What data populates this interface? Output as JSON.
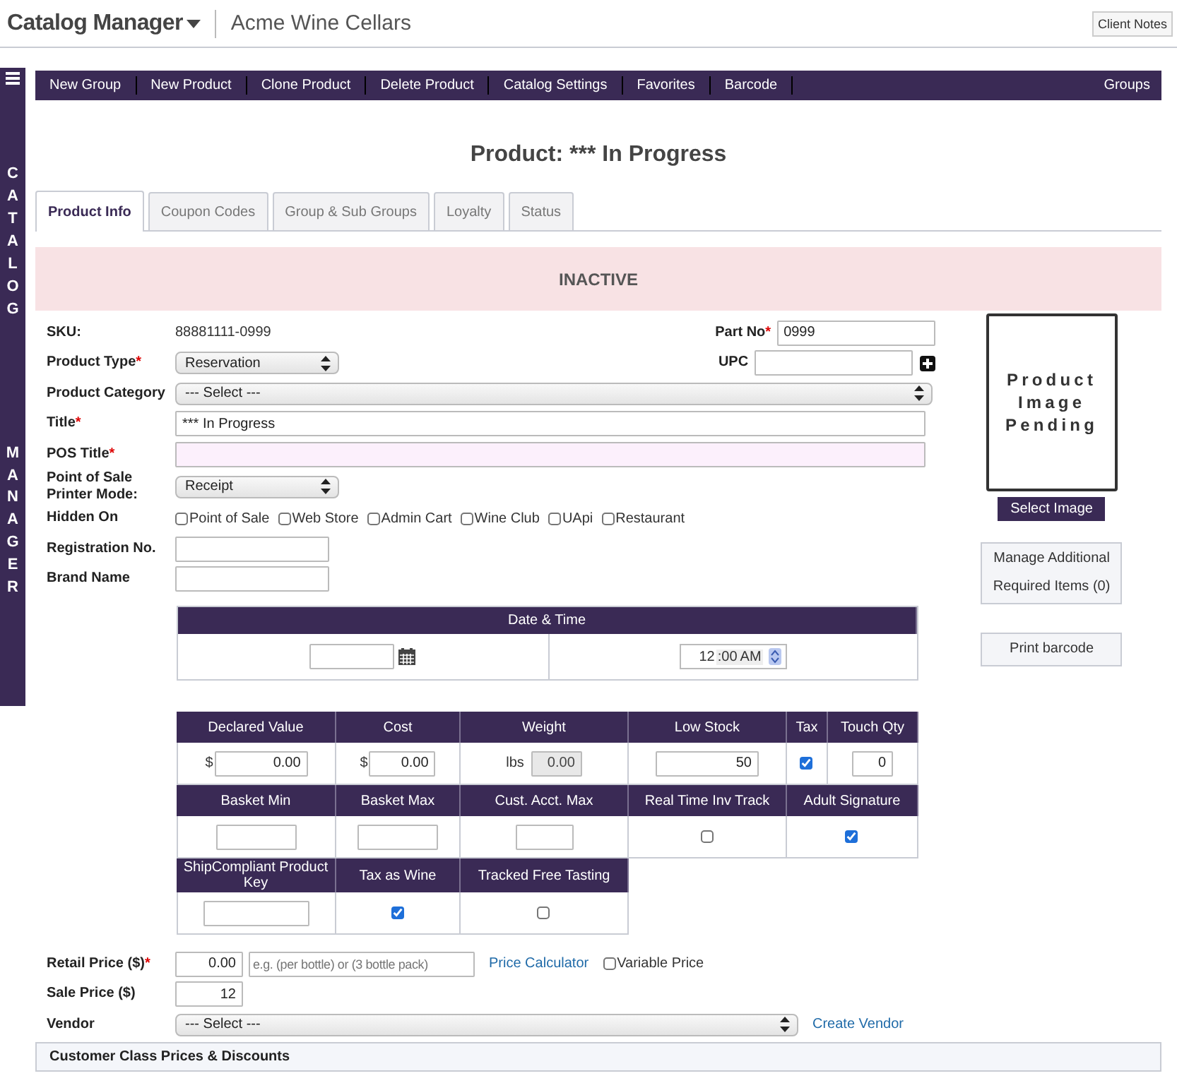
{
  "header": {
    "app_title": "Catalog Manager",
    "business": "Acme Wine Cellars",
    "client_notes": "Client Notes"
  },
  "sidebar": {
    "top_word": "CATALOG",
    "bottom_word": "MANAGER"
  },
  "toolbar": {
    "items": [
      "New Group",
      "New Product",
      "Clone Product",
      "Delete Product",
      "Catalog Settings",
      "Favorites",
      "Barcode"
    ],
    "right_item": "Groups"
  },
  "page_title": "Product: *** In Progress",
  "tabs": [
    {
      "label": "Product Info",
      "selected": true
    },
    {
      "label": "Coupon Codes",
      "selected": false
    },
    {
      "label": "Group & Sub Groups",
      "selected": false
    },
    {
      "label": "Loyalty",
      "selected": false
    },
    {
      "label": "Status",
      "selected": false
    }
  ],
  "status_banner": "INACTIVE",
  "form": {
    "rows": [
      {
        "label": "SKU:",
        "kind": "static",
        "value": "88881111-0999",
        "side": {
          "label": "Part No",
          "mark": "*",
          "value": "0999",
          "add_button": false
        }
      },
      {
        "label": "Product Type",
        "mark": "*",
        "kind": "select",
        "value": "Reservation",
        "side": {
          "label": "UPC",
          "add_button": true
        }
      },
      {
        "label": "Product Category",
        "kind": "wide-select",
        "value": "--- Select ---"
      },
      {
        "label": "Title",
        "mark": "*",
        "kind": "wide-input",
        "value": "*** In Progress",
        "highlighted": false
      },
      {
        "label": "POS Title",
        "mark": "*",
        "kind": "wide-input",
        "value": "",
        "highlighted": true
      },
      {
        "label": "Point of Sale Printer Mode:",
        "kind": "select",
        "value": "Receipt"
      },
      {
        "label": "Hidden On",
        "kind": "checkboxes",
        "options": [
          {
            "label": "Point of Sale",
            "checked": false
          },
          {
            "label": "Web Store",
            "checked": false
          },
          {
            "label": "Admin Cart",
            "checked": false
          },
          {
            "label": "Wine Club",
            "checked": false
          },
          {
            "label": "UApi",
            "checked": false
          },
          {
            "label": "Restaurant",
            "checked": false
          }
        ]
      },
      {
        "label": "Registration No.",
        "kind": "input",
        "value": ""
      },
      {
        "label": "Brand Name",
        "kind": "input",
        "value": ""
      }
    ]
  },
  "image_panel": {
    "placeholder": "Product Image Pending",
    "select_button": "Select Image",
    "manage_button": "Manage Additional Required Items (0)",
    "print_button": "Print barcode"
  },
  "date_time": {
    "title": "Date & Time",
    "hour": "12",
    "minute": ":00",
    "period": "AM"
  },
  "attributes": [
    {
      "cells": [
        {
          "header": "Declared Value",
          "kind": "money",
          "prefix": "$",
          "value": "0.00"
        },
        {
          "header": "Cost",
          "kind": "money",
          "prefix": "$",
          "value": "0.00"
        },
        {
          "header": "Weight",
          "kind": "disabled",
          "prefix": "lbs",
          "value": "0.00"
        },
        {
          "header": "Low Stock",
          "kind": "number",
          "value": "50"
        },
        {
          "header": "Tax",
          "kind": "checkbox",
          "checked": true
        },
        {
          "header": "Touch Qty",
          "kind": "small-number",
          "value": "0"
        }
      ]
    },
    {
      "cells": [
        {
          "header": "Basket Min",
          "kind": "text"
        },
        {
          "header": "Basket Max",
          "kind": "text"
        },
        {
          "header": "Cust. Acct. Max",
          "kind": "small-text"
        },
        {
          "header": "Real Time Inv Track",
          "kind": "checkbox",
          "checked": false
        },
        {
          "header": "Adult Signature",
          "kind": "checkbox",
          "checked": true
        }
      ]
    },
    {
      "cells": [
        {
          "header": "ShipCompliant Product Key",
          "kind": "text"
        },
        {
          "header": "Tax as Wine",
          "kind": "checkbox",
          "checked": true
        },
        {
          "header": "Tracked Free Tasting",
          "kind": "checkbox",
          "checked": false
        }
      ]
    }
  ],
  "pricing": {
    "retail": {
      "label": "Retail Price ($)",
      "mark": "*",
      "value": "0.00",
      "placeholder": "e.g. (per bottle) or (3 bottle pack)",
      "link": "Price Calculator",
      "variable_price": {
        "label": "Variable Price",
        "checked": false
      }
    },
    "sale": {
      "label": "Sale Price ($)",
      "value": "12"
    },
    "vendor": {
      "label": "Vendor",
      "value": "--- Select ---",
      "link": "Create Vendor"
    }
  },
  "section": "Customer Class Prices & Discounts"
}
